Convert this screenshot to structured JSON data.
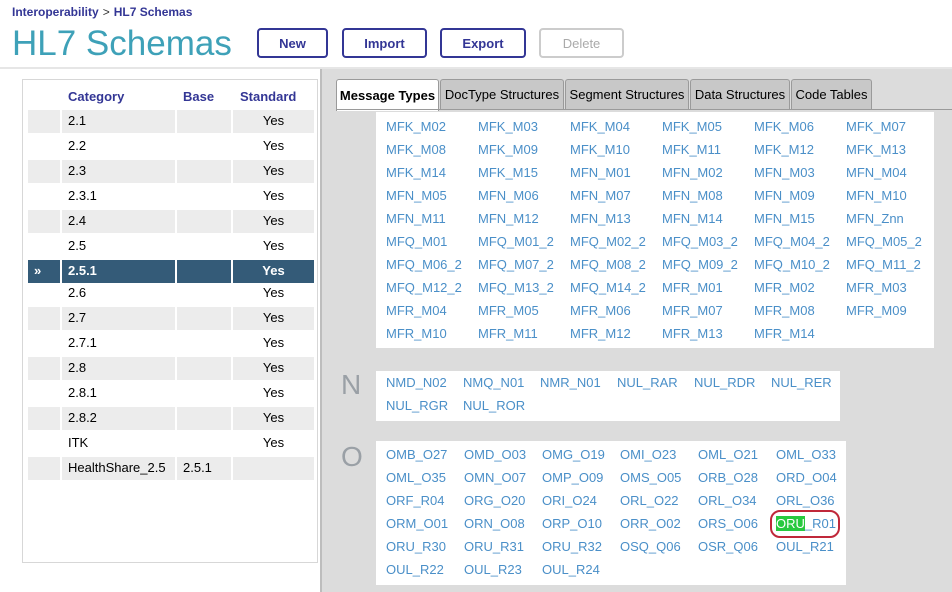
{
  "breadcrumb": {
    "parent": "Interoperability",
    "separator": ">",
    "current": "HL7 Schemas"
  },
  "page_title": "HL7 Schemas",
  "toolbar": {
    "new_label": "New",
    "import_label": "Import",
    "export_label": "Export",
    "delete_label": "Delete"
  },
  "category_table": {
    "headers": {
      "category": "Category",
      "base": "Base",
      "standard": "Standard"
    },
    "selected_marker": "»",
    "rows": [
      {
        "category": "2.1",
        "base": "",
        "standard": "Yes"
      },
      {
        "category": "2.2",
        "base": "",
        "standard": "Yes"
      },
      {
        "category": "2.3",
        "base": "",
        "standard": "Yes"
      },
      {
        "category": "2.3.1",
        "base": "",
        "standard": "Yes"
      },
      {
        "category": "2.4",
        "base": "",
        "standard": "Yes"
      },
      {
        "category": "2.5",
        "base": "",
        "standard": "Yes"
      },
      {
        "category": "2.5.1",
        "base": "",
        "standard": "Yes",
        "selected": true
      },
      {
        "category": "2.6",
        "base": "",
        "standard": "Yes"
      },
      {
        "category": "2.7",
        "base": "",
        "standard": "Yes"
      },
      {
        "category": "2.7.1",
        "base": "",
        "standard": "Yes"
      },
      {
        "category": "2.8",
        "base": "",
        "standard": "Yes"
      },
      {
        "category": "2.8.1",
        "base": "",
        "standard": "Yes"
      },
      {
        "category": "2.8.2",
        "base": "",
        "standard": "Yes"
      },
      {
        "category": "ITK",
        "base": "",
        "standard": "Yes"
      },
      {
        "category": "HealthShare_2.5",
        "base": "2.5.1",
        "standard": ""
      }
    ]
  },
  "tabs": [
    {
      "label": "Message Types",
      "active": true
    },
    {
      "label": "DocType Structures"
    },
    {
      "label": "Segment Structures"
    },
    {
      "label": "Data Structures"
    },
    {
      "label": "Code Tables"
    }
  ],
  "message_groups": [
    {
      "letter": "",
      "columns": 6,
      "items": [
        "MFK_M02",
        "MFK_M03",
        "MFK_M04",
        "MFK_M05",
        "MFK_M06",
        "MFK_M07",
        "MFK_M08",
        "MFK_M09",
        "MFK_M10",
        "MFK_M11",
        "MFK_M12",
        "MFK_M13",
        "MFK_M14",
        "MFK_M15",
        "MFN_M01",
        "MFN_M02",
        "MFN_M03",
        "MFN_M04",
        "MFN_M05",
        "MFN_M06",
        "MFN_M07",
        "MFN_M08",
        "MFN_M09",
        "MFN_M10",
        "MFN_M11",
        "MFN_M12",
        "MFN_M13",
        "MFN_M14",
        "MFN_M15",
        "MFN_Znn",
        "MFQ_M01",
        "MFQ_M01_2",
        "MFQ_M02_2",
        "MFQ_M03_2",
        "MFQ_M04_2",
        "MFQ_M05_2",
        "MFQ_M06_2",
        "MFQ_M07_2",
        "MFQ_M08_2",
        "MFQ_M09_2",
        "MFQ_M10_2",
        "MFQ_M11_2",
        "MFQ_M12_2",
        "MFQ_M13_2",
        "MFQ_M14_2",
        "MFR_M01",
        "MFR_M02",
        "MFR_M03",
        "MFR_M04",
        "MFR_M05",
        "MFR_M06",
        "MFR_M07",
        "MFR_M08",
        "MFR_M09",
        "MFR_M10",
        "MFR_M11",
        "MFR_M12",
        "MFR_M13",
        "MFR_M14"
      ]
    },
    {
      "letter": "N",
      "columns": 6,
      "items": [
        "NMD_N02",
        "NMQ_N01",
        "NMR_N01",
        "NUL_RAR",
        "NUL_RDR",
        "NUL_RER",
        "NUL_RGR",
        "NUL_ROR"
      ]
    },
    {
      "letter": "O",
      "columns": 6,
      "items": [
        "OMB_O27",
        "OMD_O03",
        "OMG_O19",
        "OMI_O23",
        "OML_O21",
        "OML_O33",
        "OML_O35",
        "OMN_O07",
        "OMP_O09",
        "OMS_O05",
        "ORB_O28",
        "ORD_O04",
        "ORF_R04",
        "ORG_O20",
        "ORI_O24",
        "ORL_O22",
        "ORL_O34",
        "ORL_O36",
        "ORM_O01",
        "ORN_O08",
        "ORP_O10",
        "ORR_O02",
        "ORS_O06",
        "ORU_R01",
        "ORU_R30",
        "ORU_R31",
        "ORU_R32",
        "OSQ_Q06",
        "OSR_Q06",
        "OUL_R21",
        "OUL_R22",
        "OUL_R23",
        "OUL_R24"
      ]
    }
  ],
  "highlight": {
    "item": "ORU_R01",
    "highlighted_text": "ORU",
    "highlight_color": "#27c93f",
    "circle_color": "#c0283a"
  },
  "colors": {
    "title": "#3ea1b8",
    "link": "#4a8fc8",
    "nav": "#333695",
    "selected_row": "#345b78",
    "panel_bg": "#dcdcdc"
  }
}
